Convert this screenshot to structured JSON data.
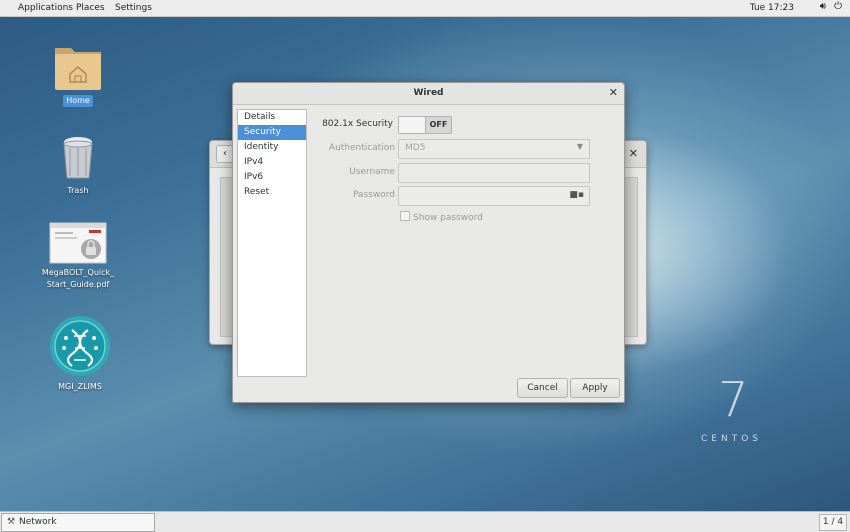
{
  "topbar": {
    "menus": [
      "Applications",
      "Places",
      "Settings"
    ],
    "clock": "Tue 17:23",
    "volume_icon": "speaker-icon",
    "power_icon": "power-icon"
  },
  "desktop": {
    "icons": [
      {
        "label": "Home",
        "icon": "home-folder-icon",
        "selected": true
      },
      {
        "label": "Trash",
        "icon": "trash-icon"
      },
      {
        "label": "MegaBOLT_Quick_Start_Guide.pdf",
        "label_line1": "MegaBOLT_Quick_",
        "label_line2": "Start_Guide.pdf",
        "icon": "pdf-thumbnail-icon"
      },
      {
        "label": "MGI_ZLIMS",
        "icon": "dna-app-icon"
      }
    ],
    "logo_number": "7",
    "logo_text": "CENTOS"
  },
  "dialog": {
    "title": "Wired",
    "sidebar": [
      {
        "label": "Details"
      },
      {
        "label": "Security",
        "active": true
      },
      {
        "label": "Identity"
      },
      {
        "label": "IPv4"
      },
      {
        "label": "IPv6"
      },
      {
        "label": "Reset"
      }
    ],
    "security": {
      "toggle_label": "802.1x Security",
      "toggle_state": "OFF",
      "auth_label": "Authentication",
      "auth_value": "MD5",
      "username_label": "Username",
      "username_value": "",
      "password_label": "Password",
      "password_value": "",
      "show_password_label": "Show password",
      "show_password_checked": false
    },
    "buttons": {
      "cancel": "Cancel",
      "apply": "Apply"
    }
  },
  "taskbar": {
    "window_label": "Network",
    "pager": "1 / 4"
  },
  "colors": {
    "selection": "#4a90d9"
  }
}
